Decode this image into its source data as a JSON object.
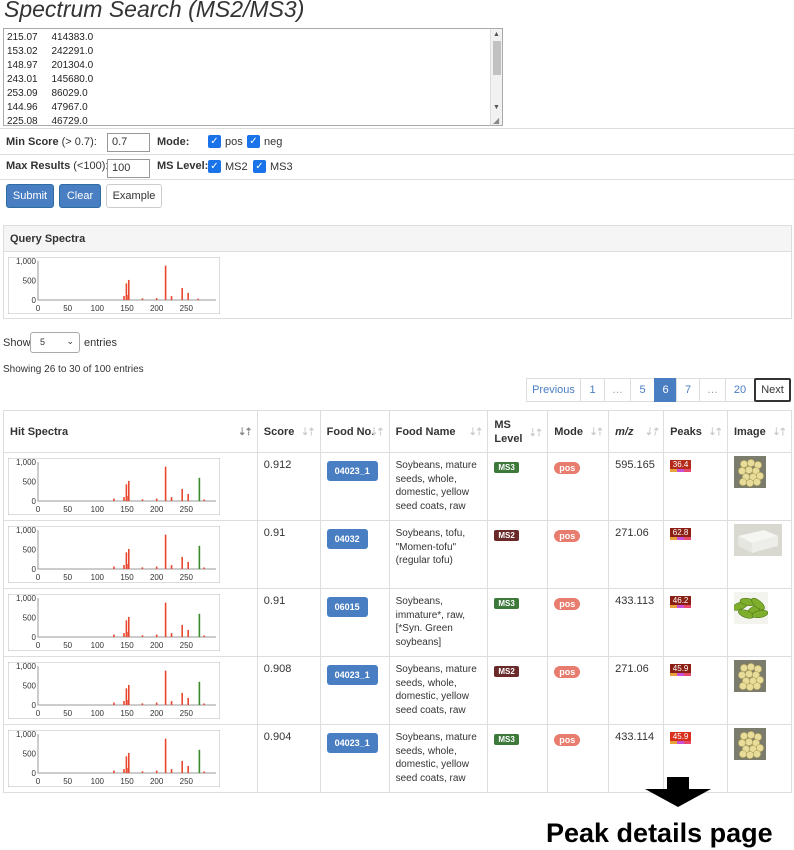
{
  "title": "Spectrum Search (MS2/MS3)",
  "spectrum_input": {
    "lines": [
      [
        "215.07",
        "414383.0"
      ],
      [
        "153.02",
        "242291.0"
      ],
      [
        "148.97",
        "201304.0"
      ],
      [
        "243.01",
        "145680.0"
      ],
      [
        "253.09",
        "86029.0"
      ],
      [
        "144.96",
        "47967.0"
      ],
      [
        "225.08",
        "46729.0"
      ]
    ]
  },
  "form": {
    "min_score_label": "Min Score",
    "min_score_hint": "(> 0.7):",
    "min_score_value": "0.7",
    "max_results_label": "Max Results",
    "max_results_hint": "(<100):",
    "max_results_value": "100",
    "mode_label": "Mode:",
    "mode_options": [
      "pos",
      "neg"
    ],
    "ms_level_label": "MS Level:",
    "ms_level_options": [
      "MS2",
      "MS3"
    ]
  },
  "buttons": {
    "submit": "Submit",
    "clear": "Clear",
    "example": "Example"
  },
  "query_panel_title": "Query Spectra",
  "show_entries": {
    "prefix": "Show",
    "value": "5",
    "suffix": "entries"
  },
  "showing_text": "Showing 26 to 30 of 100 entries",
  "pagination": {
    "previous": "Previous",
    "pages": [
      "1",
      "…",
      "5",
      "6",
      "7",
      "…",
      "20"
    ],
    "active": "6",
    "next": "Next"
  },
  "table": {
    "headers": [
      "Hit Spectra",
      "Score",
      "Food No.",
      "Food Name",
      "MS Level",
      "Mode",
      "m/z",
      "Peaks",
      "Image"
    ],
    "rows": [
      {
        "score": "0.912",
        "food_no": "04023_1",
        "food_name": "Soybeans, mature seeds, whole, domestic, yellow seed coats, raw",
        "ms_level": "MS3",
        "mode": "pos",
        "mz": "595.165",
        "peaks": "36.4",
        "image": "soybeans-icon"
      },
      {
        "score": "0.91",
        "food_no": "04032",
        "food_name": "Soybeans, tofu, \"Momen-tofu\" (regular tofu)",
        "ms_level": "MS2",
        "mode": "pos",
        "mz": "271.06",
        "peaks": "62.8",
        "image": "tofu-icon"
      },
      {
        "score": "0.91",
        "food_no": "06015",
        "food_name": "Soybeans, immature*, raw, [*Syn. Green soybeans]",
        "ms_level": "MS3",
        "mode": "pos",
        "mz": "433.113",
        "peaks": "46.2",
        "image": "edamame-icon"
      },
      {
        "score": "0.908",
        "food_no": "04023_1",
        "food_name": "Soybeans, mature seeds, whole, domestic, yellow seed coats, raw",
        "ms_level": "MS2",
        "mode": "pos",
        "mz": "271.06",
        "peaks": "45.9",
        "image": "soybeans-icon"
      },
      {
        "score": "0.904",
        "food_no": "04023_1",
        "food_name": "Soybeans, mature seeds, whole, domestic, yellow seed coats, raw",
        "ms_level": "MS3",
        "mode": "pos",
        "mz": "433.114",
        "peaks": "45.9",
        "image": "soybeans-icon"
      }
    ]
  },
  "spectrum_chart": {
    "y_ticks": [
      "1,000",
      "500",
      "0"
    ],
    "x_ticks": [
      "0",
      "50",
      "100",
      "150",
      "200",
      "250"
    ],
    "peaks": [
      [
        144.96,
        47967
      ],
      [
        148.97,
        201304
      ],
      [
        153.02,
        242291
      ],
      [
        215.07,
        414383
      ],
      [
        225.08,
        46729
      ],
      [
        243.01,
        145680
      ],
      [
        253.09,
        86029
      ]
    ]
  },
  "colors": {
    "primary": "#4a7ec2",
    "ms3": "#3d7a3a",
    "ms2": "#6b2a2a",
    "pos": "#e87c6f",
    "peak_red": "#e8472e",
    "peak_green": "#3a8a2a"
  },
  "footer_caption": "Peak details page"
}
